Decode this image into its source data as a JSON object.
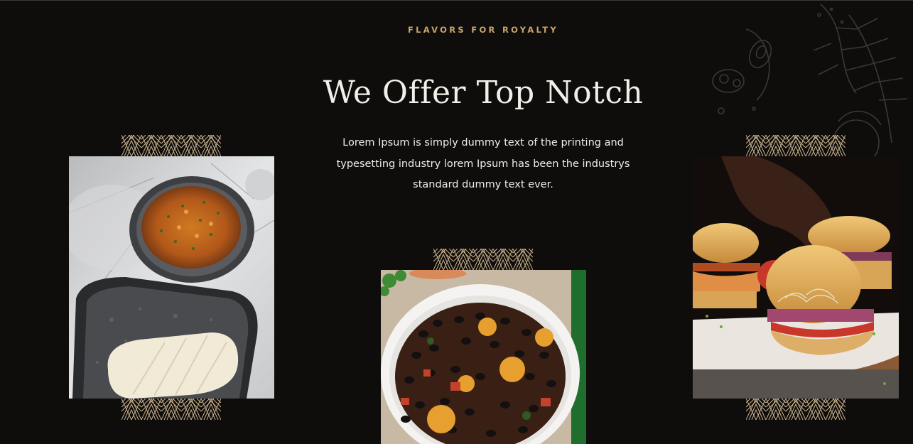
{
  "section": {
    "eyebrow": "FLAVORS FOR ROYALTY",
    "title": "We Offer Top Notch",
    "description": "Lorem Ipsum is simply dummy text of the printing and typesetting industry lorem Ipsum has been the industrys standard dummy text ever."
  },
  "gallery": [
    {
      "icon": "egusi-and-pounded-yam-photo"
    },
    {
      "icon": "black-bean-plantain-stew-photo"
    },
    {
      "icon": "chicken-sliders-photo"
    }
  ],
  "colors": {
    "background": "#0e0d0c",
    "accent": "#c9a46a",
    "text": "#f2efe9"
  }
}
